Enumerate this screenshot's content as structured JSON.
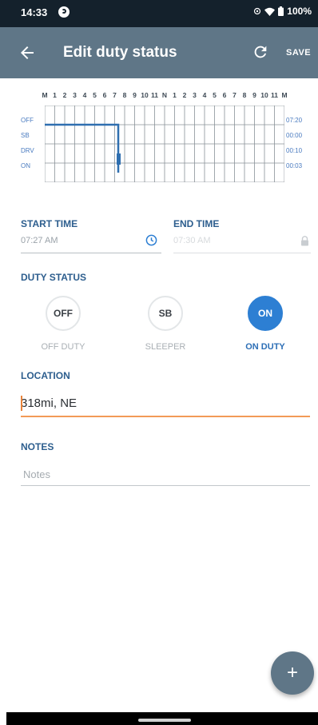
{
  "status_bar": {
    "time": "14:33",
    "battery": "100%"
  },
  "app_bar": {
    "title": "Edit duty status",
    "save_label": "SAVE",
    "back_icon": "arrow-back-icon",
    "refresh_icon": "refresh-icon",
    "background_color": "#5f7687"
  },
  "graph": {
    "hour_labels": [
      "M",
      "1",
      "2",
      "3",
      "4",
      "5",
      "6",
      "7",
      "8",
      "9",
      "10",
      "11",
      "N",
      "1",
      "2",
      "3",
      "4",
      "5",
      "6",
      "7",
      "8",
      "9",
      "10",
      "11",
      "M"
    ],
    "rows": [
      {
        "label": "OFF",
        "total": "07:20"
      },
      {
        "label": "SB",
        "total": "00:00"
      },
      {
        "label": "DRV",
        "total": "00:10"
      },
      {
        "label": "ON",
        "total": "00:03"
      }
    ],
    "line_color": "#2f6fb0"
  },
  "form": {
    "start_time_label": "START TIME",
    "start_time_value": "07:27 AM",
    "end_time_label": "END TIME",
    "end_time_value": "07:30 AM",
    "duty_status_label": "DUTY STATUS",
    "duty_options": [
      {
        "code": "OFF",
        "caption": "OFF DUTY",
        "selected": false
      },
      {
        "code": "SB",
        "caption": "SLEEPER",
        "selected": false
      },
      {
        "code": "ON",
        "caption": "ON DUTY",
        "selected": true
      }
    ],
    "location_label": "LOCATION",
    "location_value": "318mi, NE",
    "notes_label": "NOTES",
    "notes_placeholder": "Notes",
    "accent_color": "#2d7fd3",
    "focus_color": "#f29a57"
  },
  "fab": {
    "symbol": "+",
    "icon": "add-icon"
  }
}
